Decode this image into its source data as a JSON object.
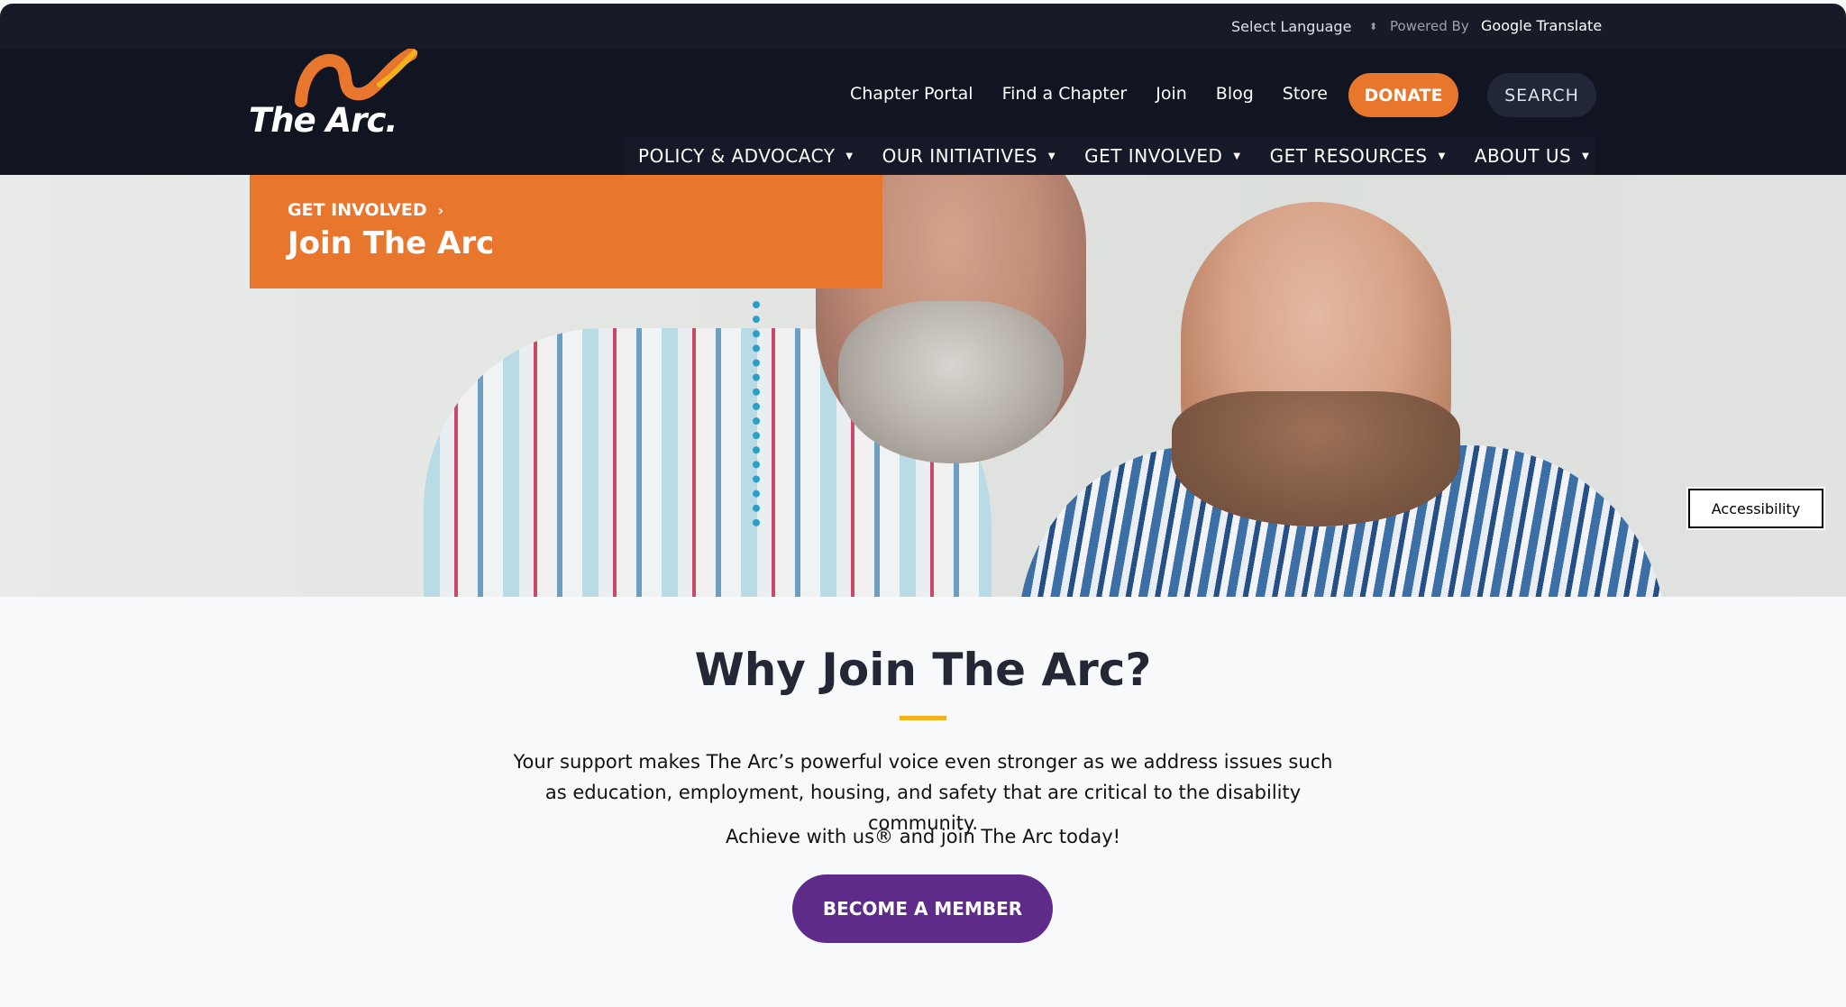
{
  "utility_bar": {
    "language_label": "Select Language",
    "powered_by": "Powered By",
    "translate_label": "Google Translate"
  },
  "header": {
    "logo_text": "The Arc.",
    "utility_links": [
      "Chapter Portal",
      "Find a Chapter",
      "Join",
      "Blog",
      "Store"
    ],
    "donate_label": "DONATE",
    "search_label": "SEARCH",
    "primary_nav": [
      "POLICY & ADVOCACY",
      "OUR INITIATIVES",
      "GET INVOLVED",
      "GET RESOURCES",
      "ABOUT US"
    ]
  },
  "hero": {
    "breadcrumb": "GET INVOLVED",
    "title": "Join The Arc",
    "accessibility_label": "Accessibility"
  },
  "content": {
    "heading": "Why Join The Arc?",
    "body": "Your support makes The Arc’s powerful voice even stronger as we address issues such as education, employment, housing, and safety that are critical to the disability community.",
    "tagline": "Achieve with us® and join The Arc today!",
    "cta_label": "BECOME A MEMBER"
  },
  "colors": {
    "header_bg": "#111521",
    "accent_orange": "#e9762d",
    "cta_purple": "#5f2b8b",
    "underline_yellow": "#f3b21b"
  }
}
